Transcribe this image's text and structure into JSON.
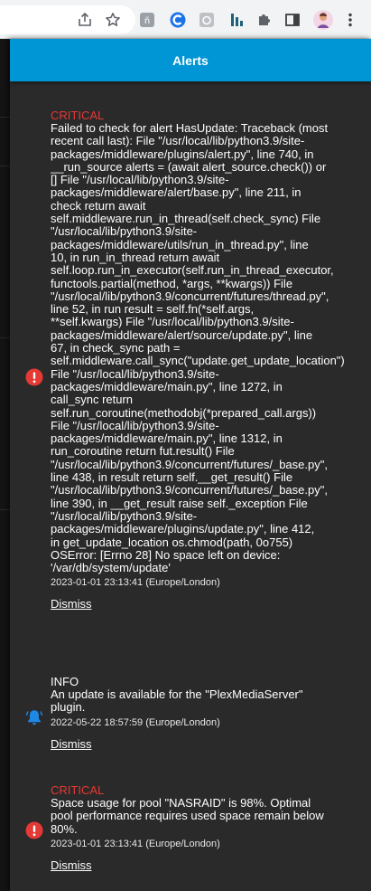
{
  "browser": {
    "toolbar_icons": [
      "share-icon",
      "star-icon",
      "extension-a-icon",
      "extension-c-icon",
      "extension-camera-icon",
      "extension-bars-icon",
      "puzzle-icon",
      "sidebar-icon",
      "profile-avatar",
      "menu-dots-icon"
    ]
  },
  "panel": {
    "title": "Alerts"
  },
  "alerts": [
    {
      "level": "CRITICAL",
      "lines": [
        "Failed to check for alert HasUpdate: Traceback (most",
        "recent call last): File \"/usr/local/lib/python3.9/site-",
        "packages/middleware/plugins/alert.py\", line 740, in",
        "__run_source alerts = (await alert_source.check()) or",
        "[] File \"/usr/local/lib/python3.9/site-",
        "packages/middleware/alert/base.py\", line 211, in",
        "check return await",
        "self.middleware.run_in_thread(self.check_sync) File",
        "\"/usr/local/lib/python3.9/site-",
        "packages/middleware/utils/run_in_thread.py\", line",
        "10, in run_in_thread return await",
        "self.loop.run_in_executor(self.run_in_thread_executor,",
        "functools.partial(method, *args, **kwargs)) File",
        "\"/usr/local/lib/python3.9/concurrent/futures/thread.py\",",
        "line 52, in run result = self.fn(*self.args,",
        "**self.kwargs) File \"/usr/local/lib/python3.9/site-",
        "packages/middleware/alert/source/update.py\", line",
        "67, in check_sync path =",
        "self.middleware.call_sync(\"update.get_update_location\")",
        "File \"/usr/local/lib/python3.9/site-",
        "packages/middleware/main.py\", line 1272, in",
        "call_sync return",
        "self.run_coroutine(methodobj(*prepared_call.args))",
        "File \"/usr/local/lib/python3.9/site-",
        "packages/middleware/main.py\", line 1312, in",
        "run_coroutine return fut.result() File",
        "\"/usr/local/lib/python3.9/concurrent/futures/_base.py\",",
        "line 438, in result return self.__get_result() File",
        "\"/usr/local/lib/python3.9/concurrent/futures/_base.py\",",
        "line 390, in __get_result raise self._exception File",
        "\"/usr/local/lib/python3.9/site-",
        "packages/middleware/plugins/update.py\", line 412,",
        "in get_update_location os.chmod(path, 0o755)",
        "OSError: [Errno 28] No space left on device:",
        "'/var/db/system/update'"
      ],
      "timestamp": "2023-01-01 23:13:41 (Europe/London)",
      "dismiss": "Dismiss",
      "icon": "error-icon"
    },
    {
      "level": "INFO",
      "lines": [
        "An update is available for the \"PlexMediaServer\"",
        "plugin."
      ],
      "timestamp": "2022-05-22 18:57:59 (Europe/London)",
      "dismiss": "Dismiss",
      "icon": "bell-icon"
    },
    {
      "level": "CRITICAL",
      "lines": [
        "Space usage for pool \"NASRAID\" is 98%. Optimal",
        "pool performance requires used space remain below",
        "80%."
      ],
      "timestamp": "2023-01-01 23:13:41 (Europe/London)",
      "dismiss": "Dismiss",
      "icon": "error-icon"
    }
  ],
  "colors": {
    "header": "#0095d5",
    "critical": "#e53935",
    "info_icon": "#1e88e5",
    "panel_bg": "#2a2a2a"
  }
}
